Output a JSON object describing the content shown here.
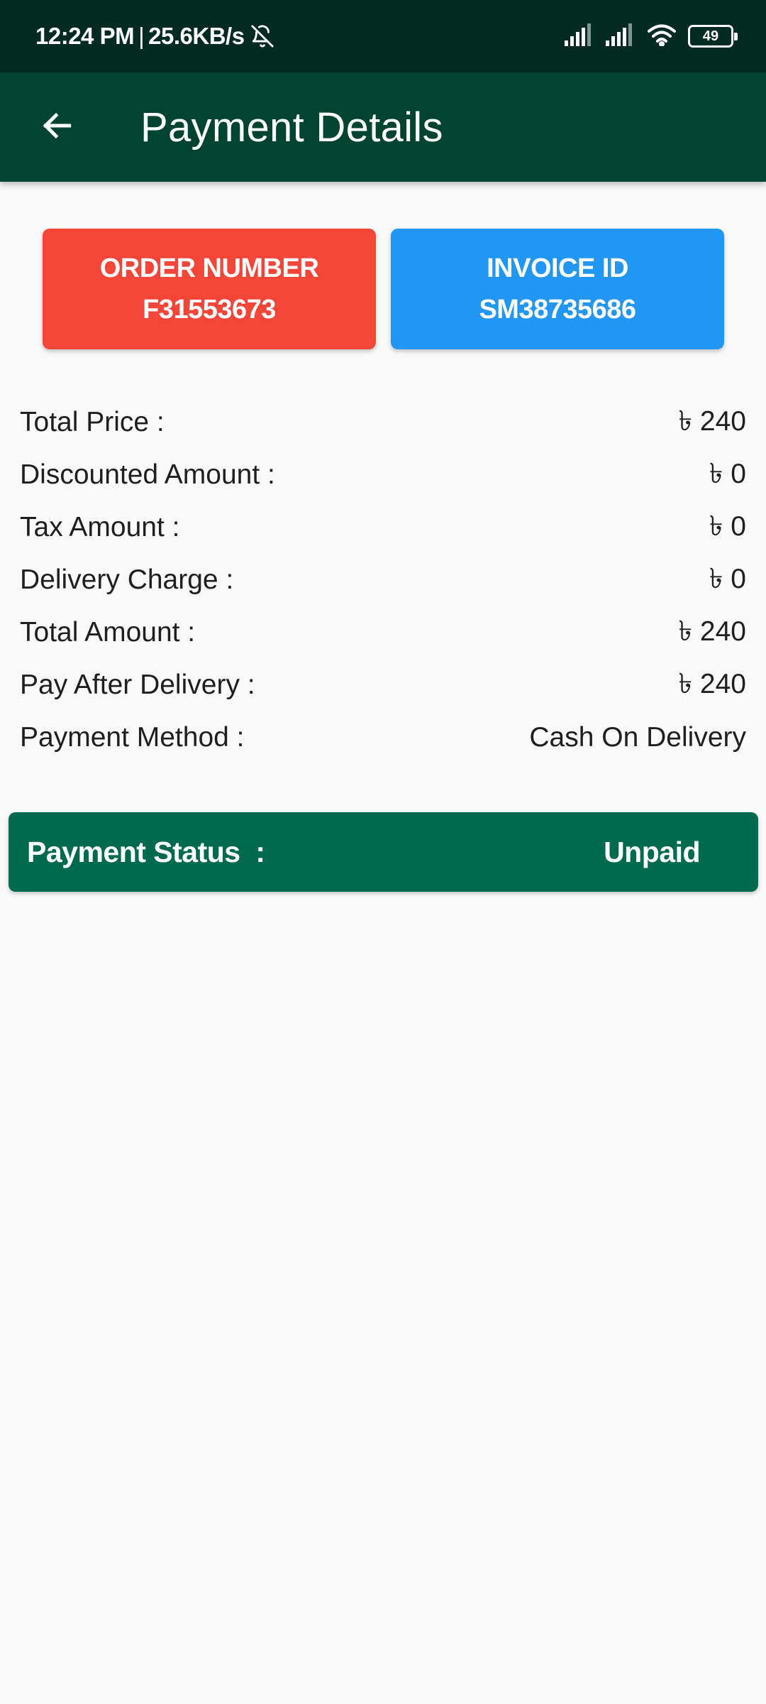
{
  "status_bar": {
    "time": "12:24 PM",
    "separator": "|",
    "network_speed": "25.6KB/s",
    "battery": "49",
    "icons": [
      "bell-off-icon",
      "signal-icon",
      "signal-icon",
      "wifi-icon",
      "battery-icon"
    ]
  },
  "app_bar": {
    "title": "Payment Details",
    "back_icon": "arrow-left-icon"
  },
  "order": {
    "label": "ORDER NUMBER",
    "value": "F31553673"
  },
  "invoice": {
    "label": "INVOICE ID",
    "value": "SM38735686"
  },
  "details": [
    {
      "label": "Total Price :",
      "value": "৳ 240"
    },
    {
      "label": "Discounted Amount :",
      "value": "৳ 0"
    },
    {
      "label": "Tax Amount :",
      "value": "৳ 0"
    },
    {
      "label": "Delivery Charge :",
      "value": "৳ 0"
    },
    {
      "label": "Total Amount :",
      "value": "৳ 240"
    },
    {
      "label": "Pay After Delivery :",
      "value": "৳ 240"
    },
    {
      "label": "Payment Method :",
      "value": "Cash On Delivery"
    }
  ],
  "payment_status": {
    "label": "Payment Status  :",
    "value": "Unpaid"
  },
  "colors": {
    "status_bar": "#012a21",
    "app_bar": "#00432e",
    "order_card": "#f44539",
    "invoice_card": "#2296f3",
    "status_card": "#006a4e",
    "background": "#f9f9f9"
  }
}
